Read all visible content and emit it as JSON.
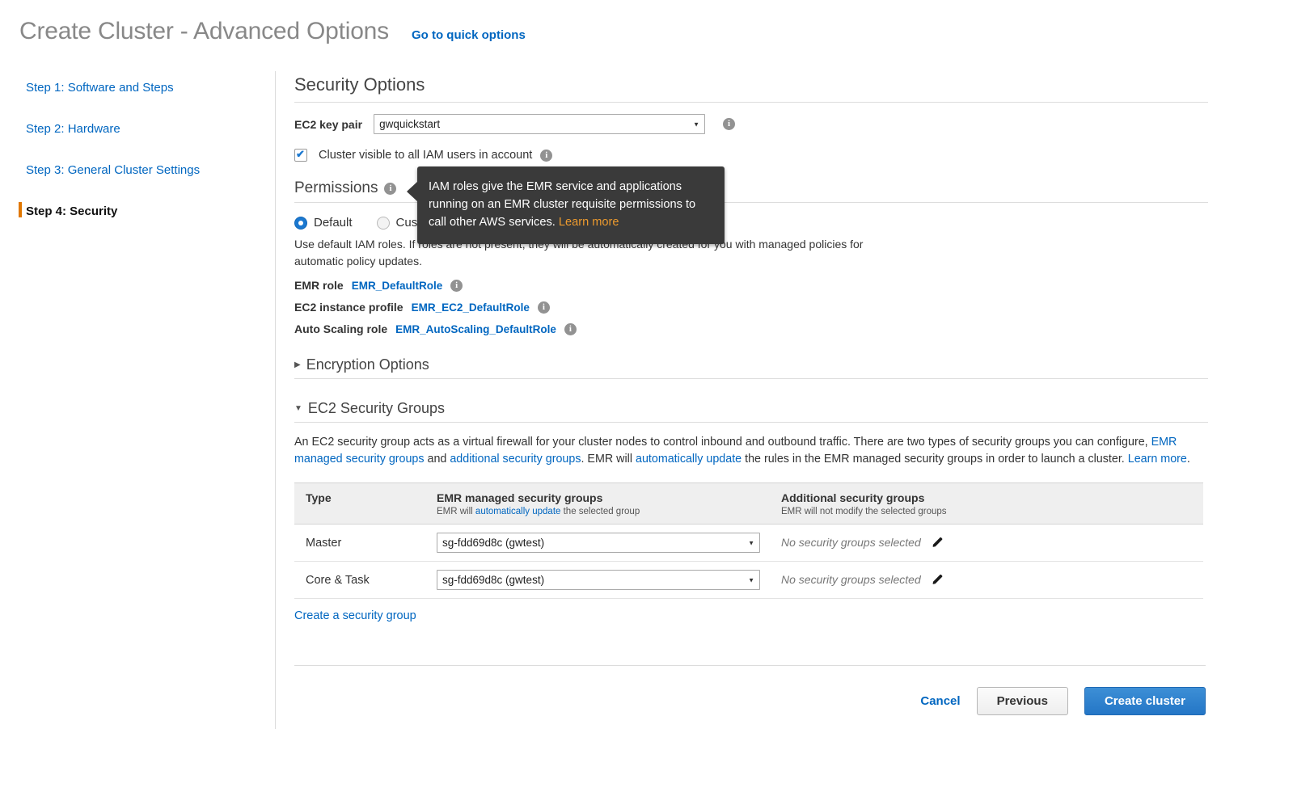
{
  "header": {
    "title": "Create Cluster - Advanced Options",
    "quick_options_link": "Go to quick options"
  },
  "sidebar": {
    "items": [
      {
        "label": "Step 1: Software and Steps",
        "active": false
      },
      {
        "label": "Step 2: Hardware",
        "active": false
      },
      {
        "label": "Step 3: General Cluster Settings",
        "active": false
      },
      {
        "label": "Step 4: Security",
        "active": true
      }
    ]
  },
  "main": {
    "section_title": "Security Options",
    "key_pair": {
      "label": "EC2 key pair",
      "value": "gwquickstart",
      "options": [
        "gwquickstart"
      ]
    },
    "visible_checkbox": {
      "label": "Cluster visible to all IAM users in account",
      "checked": true
    },
    "permissions": {
      "title": "Permissions",
      "option_default": "Default",
      "option_custom": "Custom",
      "selected": "Default",
      "description": "Use default IAM roles. If roles are not present, they will be automatically created for you with managed policies for automatic policy updates.",
      "roles": [
        {
          "label": "EMR role",
          "value": "EMR_DefaultRole"
        },
        {
          "label": "EC2 instance profile",
          "value": "EMR_EC2_DefaultRole"
        },
        {
          "label": "Auto Scaling role",
          "value": "EMR_AutoScaling_DefaultRole"
        }
      ]
    },
    "encryption": {
      "title": "Encryption Options",
      "expanded": false,
      "caret": "▶"
    },
    "security_groups": {
      "title": "EC2 Security Groups",
      "expanded": true,
      "caret": "▼",
      "paragraph": {
        "p1": "An EC2 security group acts as a virtual firewall for your cluster nodes to control inbound and outbound traffic. There are two types of security groups you can configure, ",
        "link1": "EMR managed security groups",
        "p2": " and ",
        "link2": "additional security groups",
        "p3": ". EMR will ",
        "link3": "automatically update",
        "p4": " the rules in the EMR managed security groups in order to launch a cluster. ",
        "link4": "Learn more",
        "p5": "."
      },
      "table": {
        "columns": [
          {
            "title": "Type",
            "sub": ""
          },
          {
            "title": "EMR managed security groups",
            "sub_pre": "EMR will ",
            "sub_link": "automatically update",
            "sub_post": " the selected group"
          },
          {
            "title": "Additional security groups",
            "sub": "EMR will not modify the selected groups"
          }
        ],
        "rows": [
          {
            "type": "Master",
            "managed_group": "sg-fdd69d8c (gwtest)",
            "additional_groups": "No security groups selected"
          },
          {
            "type": "Core & Task",
            "managed_group": "sg-fdd69d8c (gwtest)",
            "additional_groups": "No security groups selected"
          }
        ]
      },
      "create_link": "Create a security group"
    }
  },
  "tooltip": {
    "text": "IAM roles give the EMR service and applications running on an EMR cluster requisite permissions to call other AWS services. ",
    "link": "Learn more"
  },
  "footer": {
    "cancel": "Cancel",
    "previous": "Previous",
    "create": "Create cluster"
  },
  "icons": {
    "info": "i"
  }
}
